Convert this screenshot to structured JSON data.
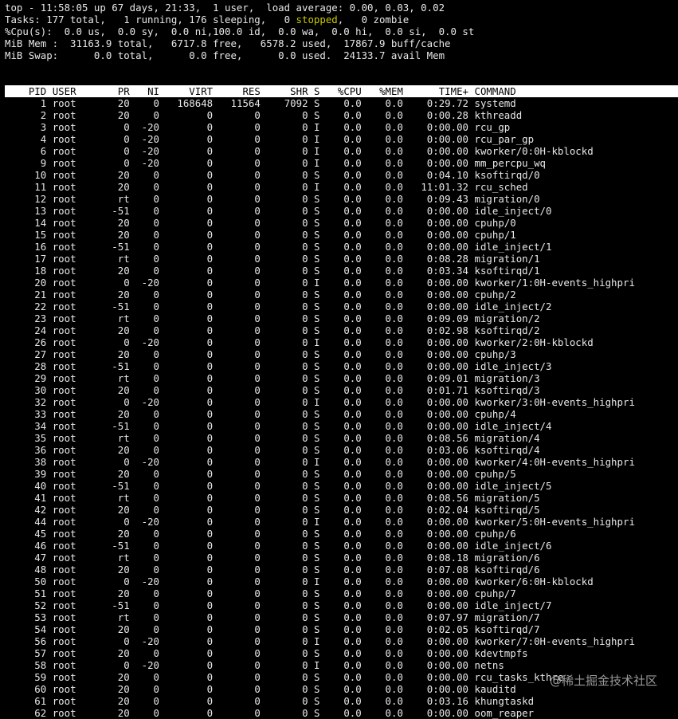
{
  "summary": {
    "line1": "top - 11:58:05 up 67 days, 21:33,  1 user,  load average: 0.00, 0.03, 0.02",
    "line2": {
      "before": "Tasks: 177 total,   1 running, 176 sleeping,   0 ",
      "stopped": "stopped",
      "after": ",   0 zombie"
    },
    "line3": "%Cpu(s):  0.0 us,  0.0 sy,  0.0 ni,100.0 id,  0.0 wa,  0.0 hi,  0.0 si,  0.0 st",
    "line4": "MiB Mem :  31163.9 total,   6717.8 free,   6578.2 used,  17867.9 buff/cache",
    "line5": "MiB Swap:      0.0 total,      0.0 free,      0.0 used.  24133.7 avail Mem"
  },
  "colors": {
    "background": "#000000",
    "text": "#e8e8e8",
    "stopped": "#c8c800",
    "header_bg": "#ffffff",
    "header_text": "#000000"
  },
  "table": {
    "columns": [
      "PID",
      "USER",
      "PR",
      "NI",
      "VIRT",
      "RES",
      "SHR",
      "S",
      "%CPU",
      "%MEM",
      "TIME+",
      "COMMAND"
    ],
    "rows": [
      [
        "1",
        "root",
        "20",
        "0",
        "168648",
        "11564",
        "7092",
        "S",
        "0.0",
        "0.0",
        "0:29.72",
        "systemd"
      ],
      [
        "2",
        "root",
        "20",
        "0",
        "0",
        "0",
        "0",
        "S",
        "0.0",
        "0.0",
        "0:00.28",
        "kthreadd"
      ],
      [
        "3",
        "root",
        "0",
        "-20",
        "0",
        "0",
        "0",
        "I",
        "0.0",
        "0.0",
        "0:00.00",
        "rcu_gp"
      ],
      [
        "4",
        "root",
        "0",
        "-20",
        "0",
        "0",
        "0",
        "I",
        "0.0",
        "0.0",
        "0:00.00",
        "rcu_par_gp"
      ],
      [
        "6",
        "root",
        "0",
        "-20",
        "0",
        "0",
        "0",
        "I",
        "0.0",
        "0.0",
        "0:00.00",
        "kworker/0:0H-kblockd"
      ],
      [
        "9",
        "root",
        "0",
        "-20",
        "0",
        "0",
        "0",
        "I",
        "0.0",
        "0.0",
        "0:00.00",
        "mm_percpu_wq"
      ],
      [
        "10",
        "root",
        "20",
        "0",
        "0",
        "0",
        "0",
        "S",
        "0.0",
        "0.0",
        "0:04.10",
        "ksoftirqd/0"
      ],
      [
        "11",
        "root",
        "20",
        "0",
        "0",
        "0",
        "0",
        "I",
        "0.0",
        "0.0",
        "11:01.32",
        "rcu_sched"
      ],
      [
        "12",
        "root",
        "rt",
        "0",
        "0",
        "0",
        "0",
        "S",
        "0.0",
        "0.0",
        "0:09.43",
        "migration/0"
      ],
      [
        "13",
        "root",
        "-51",
        "0",
        "0",
        "0",
        "0",
        "S",
        "0.0",
        "0.0",
        "0:00.00",
        "idle_inject/0"
      ],
      [
        "14",
        "root",
        "20",
        "0",
        "0",
        "0",
        "0",
        "S",
        "0.0",
        "0.0",
        "0:00.00",
        "cpuhp/0"
      ],
      [
        "15",
        "root",
        "20",
        "0",
        "0",
        "0",
        "0",
        "S",
        "0.0",
        "0.0",
        "0:00.00",
        "cpuhp/1"
      ],
      [
        "16",
        "root",
        "-51",
        "0",
        "0",
        "0",
        "0",
        "S",
        "0.0",
        "0.0",
        "0:00.00",
        "idle_inject/1"
      ],
      [
        "17",
        "root",
        "rt",
        "0",
        "0",
        "0",
        "0",
        "S",
        "0.0",
        "0.0",
        "0:08.28",
        "migration/1"
      ],
      [
        "18",
        "root",
        "20",
        "0",
        "0",
        "0",
        "0",
        "S",
        "0.0",
        "0.0",
        "0:03.34",
        "ksoftirqd/1"
      ],
      [
        "20",
        "root",
        "0",
        "-20",
        "0",
        "0",
        "0",
        "I",
        "0.0",
        "0.0",
        "0:00.00",
        "kworker/1:0H-events_highpri"
      ],
      [
        "21",
        "root",
        "20",
        "0",
        "0",
        "0",
        "0",
        "S",
        "0.0",
        "0.0",
        "0:00.00",
        "cpuhp/2"
      ],
      [
        "22",
        "root",
        "-51",
        "0",
        "0",
        "0",
        "0",
        "S",
        "0.0",
        "0.0",
        "0:00.00",
        "idle_inject/2"
      ],
      [
        "23",
        "root",
        "rt",
        "0",
        "0",
        "0",
        "0",
        "S",
        "0.0",
        "0.0",
        "0:09.09",
        "migration/2"
      ],
      [
        "24",
        "root",
        "20",
        "0",
        "0",
        "0",
        "0",
        "S",
        "0.0",
        "0.0",
        "0:02.98",
        "ksoftirqd/2"
      ],
      [
        "26",
        "root",
        "0",
        "-20",
        "0",
        "0",
        "0",
        "I",
        "0.0",
        "0.0",
        "0:00.00",
        "kworker/2:0H-kblockd"
      ],
      [
        "27",
        "root",
        "20",
        "0",
        "0",
        "0",
        "0",
        "S",
        "0.0",
        "0.0",
        "0:00.00",
        "cpuhp/3"
      ],
      [
        "28",
        "root",
        "-51",
        "0",
        "0",
        "0",
        "0",
        "S",
        "0.0",
        "0.0",
        "0:00.00",
        "idle_inject/3"
      ],
      [
        "29",
        "root",
        "rt",
        "0",
        "0",
        "0",
        "0",
        "S",
        "0.0",
        "0.0",
        "0:09.01",
        "migration/3"
      ],
      [
        "30",
        "root",
        "20",
        "0",
        "0",
        "0",
        "0",
        "S",
        "0.0",
        "0.0",
        "0:01.71",
        "ksoftirqd/3"
      ],
      [
        "32",
        "root",
        "0",
        "-20",
        "0",
        "0",
        "0",
        "I",
        "0.0",
        "0.0",
        "0:00.00",
        "kworker/3:0H-events_highpri"
      ],
      [
        "33",
        "root",
        "20",
        "0",
        "0",
        "0",
        "0",
        "S",
        "0.0",
        "0.0",
        "0:00.00",
        "cpuhp/4"
      ],
      [
        "34",
        "root",
        "-51",
        "0",
        "0",
        "0",
        "0",
        "S",
        "0.0",
        "0.0",
        "0:00.00",
        "idle_inject/4"
      ],
      [
        "35",
        "root",
        "rt",
        "0",
        "0",
        "0",
        "0",
        "S",
        "0.0",
        "0.0",
        "0:08.56",
        "migration/4"
      ],
      [
        "36",
        "root",
        "20",
        "0",
        "0",
        "0",
        "0",
        "S",
        "0.0",
        "0.0",
        "0:03.06",
        "ksoftirqd/4"
      ],
      [
        "38",
        "root",
        "0",
        "-20",
        "0",
        "0",
        "0",
        "I",
        "0.0",
        "0.0",
        "0:00.00",
        "kworker/4:0H-events_highpri"
      ],
      [
        "39",
        "root",
        "20",
        "0",
        "0",
        "0",
        "0",
        "S",
        "0.0",
        "0.0",
        "0:00.00",
        "cpuhp/5"
      ],
      [
        "40",
        "root",
        "-51",
        "0",
        "0",
        "0",
        "0",
        "S",
        "0.0",
        "0.0",
        "0:00.00",
        "idle_inject/5"
      ],
      [
        "41",
        "root",
        "rt",
        "0",
        "0",
        "0",
        "0",
        "S",
        "0.0",
        "0.0",
        "0:08.56",
        "migration/5"
      ],
      [
        "42",
        "root",
        "20",
        "0",
        "0",
        "0",
        "0",
        "S",
        "0.0",
        "0.0",
        "0:02.04",
        "ksoftirqd/5"
      ],
      [
        "44",
        "root",
        "0",
        "-20",
        "0",
        "0",
        "0",
        "I",
        "0.0",
        "0.0",
        "0:00.00",
        "kworker/5:0H-events_highpri"
      ],
      [
        "45",
        "root",
        "20",
        "0",
        "0",
        "0",
        "0",
        "S",
        "0.0",
        "0.0",
        "0:00.00",
        "cpuhp/6"
      ],
      [
        "46",
        "root",
        "-51",
        "0",
        "0",
        "0",
        "0",
        "S",
        "0.0",
        "0.0",
        "0:00.00",
        "idle_inject/6"
      ],
      [
        "47",
        "root",
        "rt",
        "0",
        "0",
        "0",
        "0",
        "S",
        "0.0",
        "0.0",
        "0:08.18",
        "migration/6"
      ],
      [
        "48",
        "root",
        "20",
        "0",
        "0",
        "0",
        "0",
        "S",
        "0.0",
        "0.0",
        "0:07.08",
        "ksoftirqd/6"
      ],
      [
        "50",
        "root",
        "0",
        "-20",
        "0",
        "0",
        "0",
        "I",
        "0.0",
        "0.0",
        "0:00.00",
        "kworker/6:0H-kblockd"
      ],
      [
        "51",
        "root",
        "20",
        "0",
        "0",
        "0",
        "0",
        "S",
        "0.0",
        "0.0",
        "0:00.00",
        "cpuhp/7"
      ],
      [
        "52",
        "root",
        "-51",
        "0",
        "0",
        "0",
        "0",
        "S",
        "0.0",
        "0.0",
        "0:00.00",
        "idle_inject/7"
      ],
      [
        "53",
        "root",
        "rt",
        "0",
        "0",
        "0",
        "0",
        "S",
        "0.0",
        "0.0",
        "0:07.97",
        "migration/7"
      ],
      [
        "54",
        "root",
        "20",
        "0",
        "0",
        "0",
        "0",
        "S",
        "0.0",
        "0.0",
        "0:02.05",
        "ksoftirqd/7"
      ],
      [
        "56",
        "root",
        "0",
        "-20",
        "0",
        "0",
        "0",
        "I",
        "0.0",
        "0.0",
        "0:00.00",
        "kworker/7:0H-events_highpri"
      ],
      [
        "57",
        "root",
        "20",
        "0",
        "0",
        "0",
        "0",
        "S",
        "0.0",
        "0.0",
        "0:00.00",
        "kdevtmpfs"
      ],
      [
        "58",
        "root",
        "0",
        "-20",
        "0",
        "0",
        "0",
        "I",
        "0.0",
        "0.0",
        "0:00.00",
        "netns"
      ],
      [
        "59",
        "root",
        "20",
        "0",
        "0",
        "0",
        "0",
        "S",
        "0.0",
        "0.0",
        "0:00.00",
        "rcu_tasks_kthre"
      ],
      [
        "60",
        "root",
        "20",
        "0",
        "0",
        "0",
        "0",
        "S",
        "0.0",
        "0.0",
        "0:00.00",
        "kauditd"
      ],
      [
        "61",
        "root",
        "20",
        "0",
        "0",
        "0",
        "0",
        "S",
        "0.0",
        "0.0",
        "0:03.16",
        "khungtaskd"
      ],
      [
        "62",
        "root",
        "20",
        "0",
        "0",
        "0",
        "0",
        "S",
        "0.0",
        "0.0",
        "0:00.00",
        "oom_reaper"
      ]
    ]
  },
  "watermark": "@稀土掘金技术社区"
}
